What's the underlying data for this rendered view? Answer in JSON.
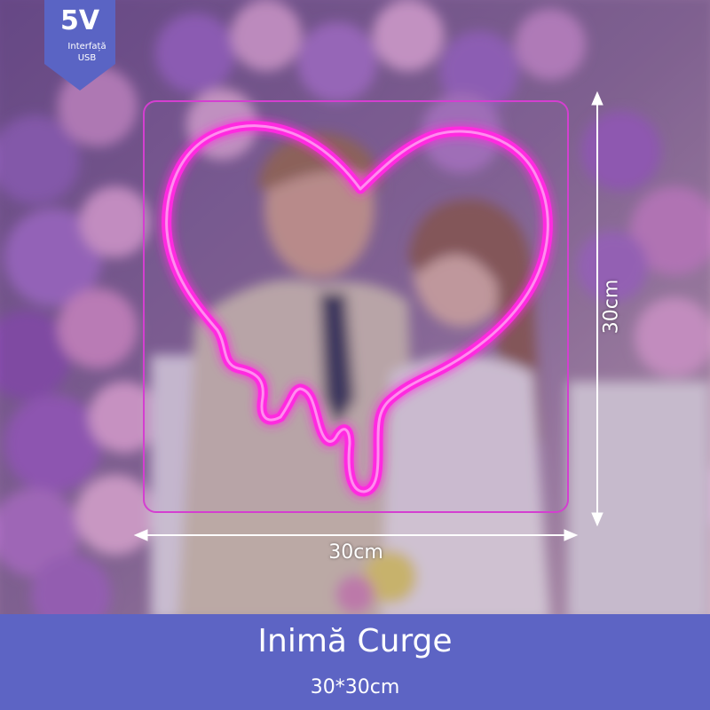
{
  "badge": {
    "voltage": "5V",
    "interface_line1": "Interfață",
    "interface_line2": "USB"
  },
  "dimensions": {
    "width_label": "30cm",
    "height_label": "30cm"
  },
  "product": {
    "name": "Inimă Curge",
    "size": "30*30cm"
  },
  "colors": {
    "neon": "#ff2be0",
    "neon_board": "#d43fd0",
    "footer_band": "#5d64c4",
    "badge": "#5a64c4",
    "arrows": "#ffffff"
  },
  "icons": {
    "product_shape": "dripping-heart-icon",
    "arrow": "double-arrow-icon"
  }
}
